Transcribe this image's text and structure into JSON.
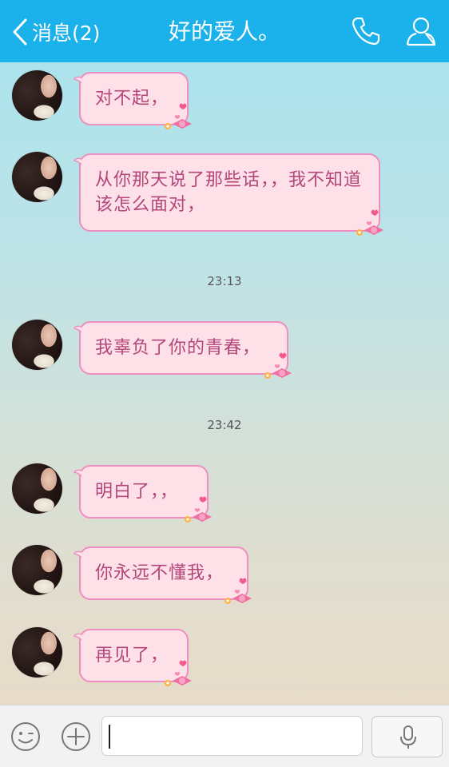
{
  "header": {
    "back_label": "消息(2)",
    "title": "好的爱人。",
    "icons": [
      "chevron-left-icon",
      "phone-icon",
      "profile-icon"
    ]
  },
  "messages": [
    {
      "text": "对不起，"
    },
    {
      "text": "从你那天说了那些话，，我不知道该怎么面对，"
    },
    {
      "text": "我辜负了你的青春，"
    },
    {
      "text": "明白了，，"
    },
    {
      "text": "你永远不懂我，"
    },
    {
      "text": "再见了，"
    }
  ],
  "timestamps": [
    "23:13",
    "23:42"
  ],
  "input": {
    "value": "",
    "icons": [
      "emoji-icon",
      "plus-icon",
      "microphone-icon"
    ]
  },
  "colors": {
    "header_bg": "#1bb1ea",
    "bubble_bg": "#fde0e8",
    "bubble_border": "#ee8fc2",
    "bubble_text": "#b3477a"
  }
}
